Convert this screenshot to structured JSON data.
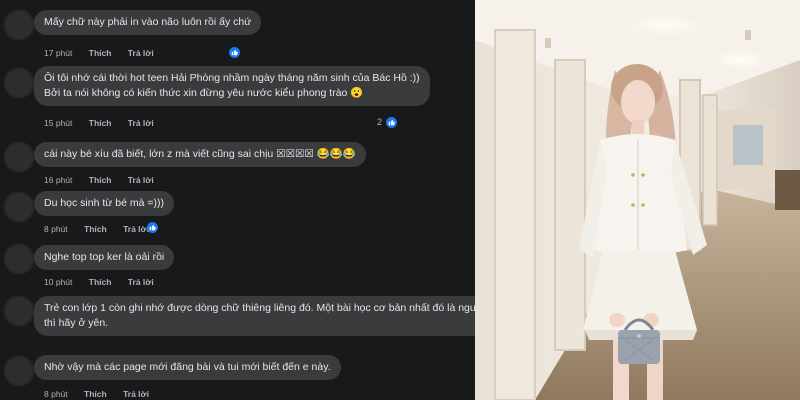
{
  "comments": [
    {
      "lines": [
        "Mấy chữ này phải in vào não luôn rồi ấy chứ"
      ],
      "time": "17 phút",
      "like": "Thích",
      "reply": "Trả lời",
      "reacted": true,
      "react_count": ""
    },
    {
      "lines": [
        "Ôi tôi nhớ cái thời hot teen Hải Phòng nhầm ngày tháng năm sinh của Bác Hồ :))",
        "Bởi ta nói không có kiến thức xin đừng yêu nước kiểu phong trào 😮"
      ],
      "time": "15 phút",
      "like": "Thích",
      "reply": "Trả lời",
      "reacted": true,
      "react_count": "2"
    },
    {
      "lines": [
        "cái này bé xíu đã biết, lớn z mà viết cũng sai chịu ☒☒☒☒ 😂😂😂"
      ],
      "time": "16 phút",
      "like": "Thích",
      "reply": "Trả lời",
      "reacted": false,
      "react_count": ""
    },
    {
      "lines": [
        "Du học sinh từ bé mà =)))"
      ],
      "time": "8 phút",
      "like": "Thích",
      "reply": "Trả lời",
      "reacted": true,
      "react_count": ""
    },
    {
      "lines": [
        "Nghe top top ker là oải rồi"
      ],
      "time": "10 phút",
      "like": "Thích",
      "reply": "Trả lời",
      "reacted": false,
      "react_count": ""
    },
    {
      "lines": [
        "Trẻ con lớp 1 còn ghi nhớ được dòng chữ thiêng liêng đó. Một bài học cơ bản nhất đó là ngu",
        "thì hãy ở yên."
      ],
      "time": "",
      "like": "",
      "reply": "",
      "reacted": false,
      "react_count": ""
    },
    {
      "lines": [
        "Nhờ vậy mà các page mới đăng bài và tui mới biết đến e này."
      ],
      "time": "8 phút",
      "like": "Thích",
      "reply": "Trả lời",
      "reacted": false,
      "react_count": ""
    }
  ],
  "colors": {
    "background": "#18191a",
    "bubble": "#3a3b3c",
    "text": "#e4e6eb",
    "meta": "#b0b3b8",
    "like_blue": "#1877f2"
  },
  "icons": {
    "reaction": "thumbs-up-icon",
    "emoji": "laughing-face-icon"
  }
}
